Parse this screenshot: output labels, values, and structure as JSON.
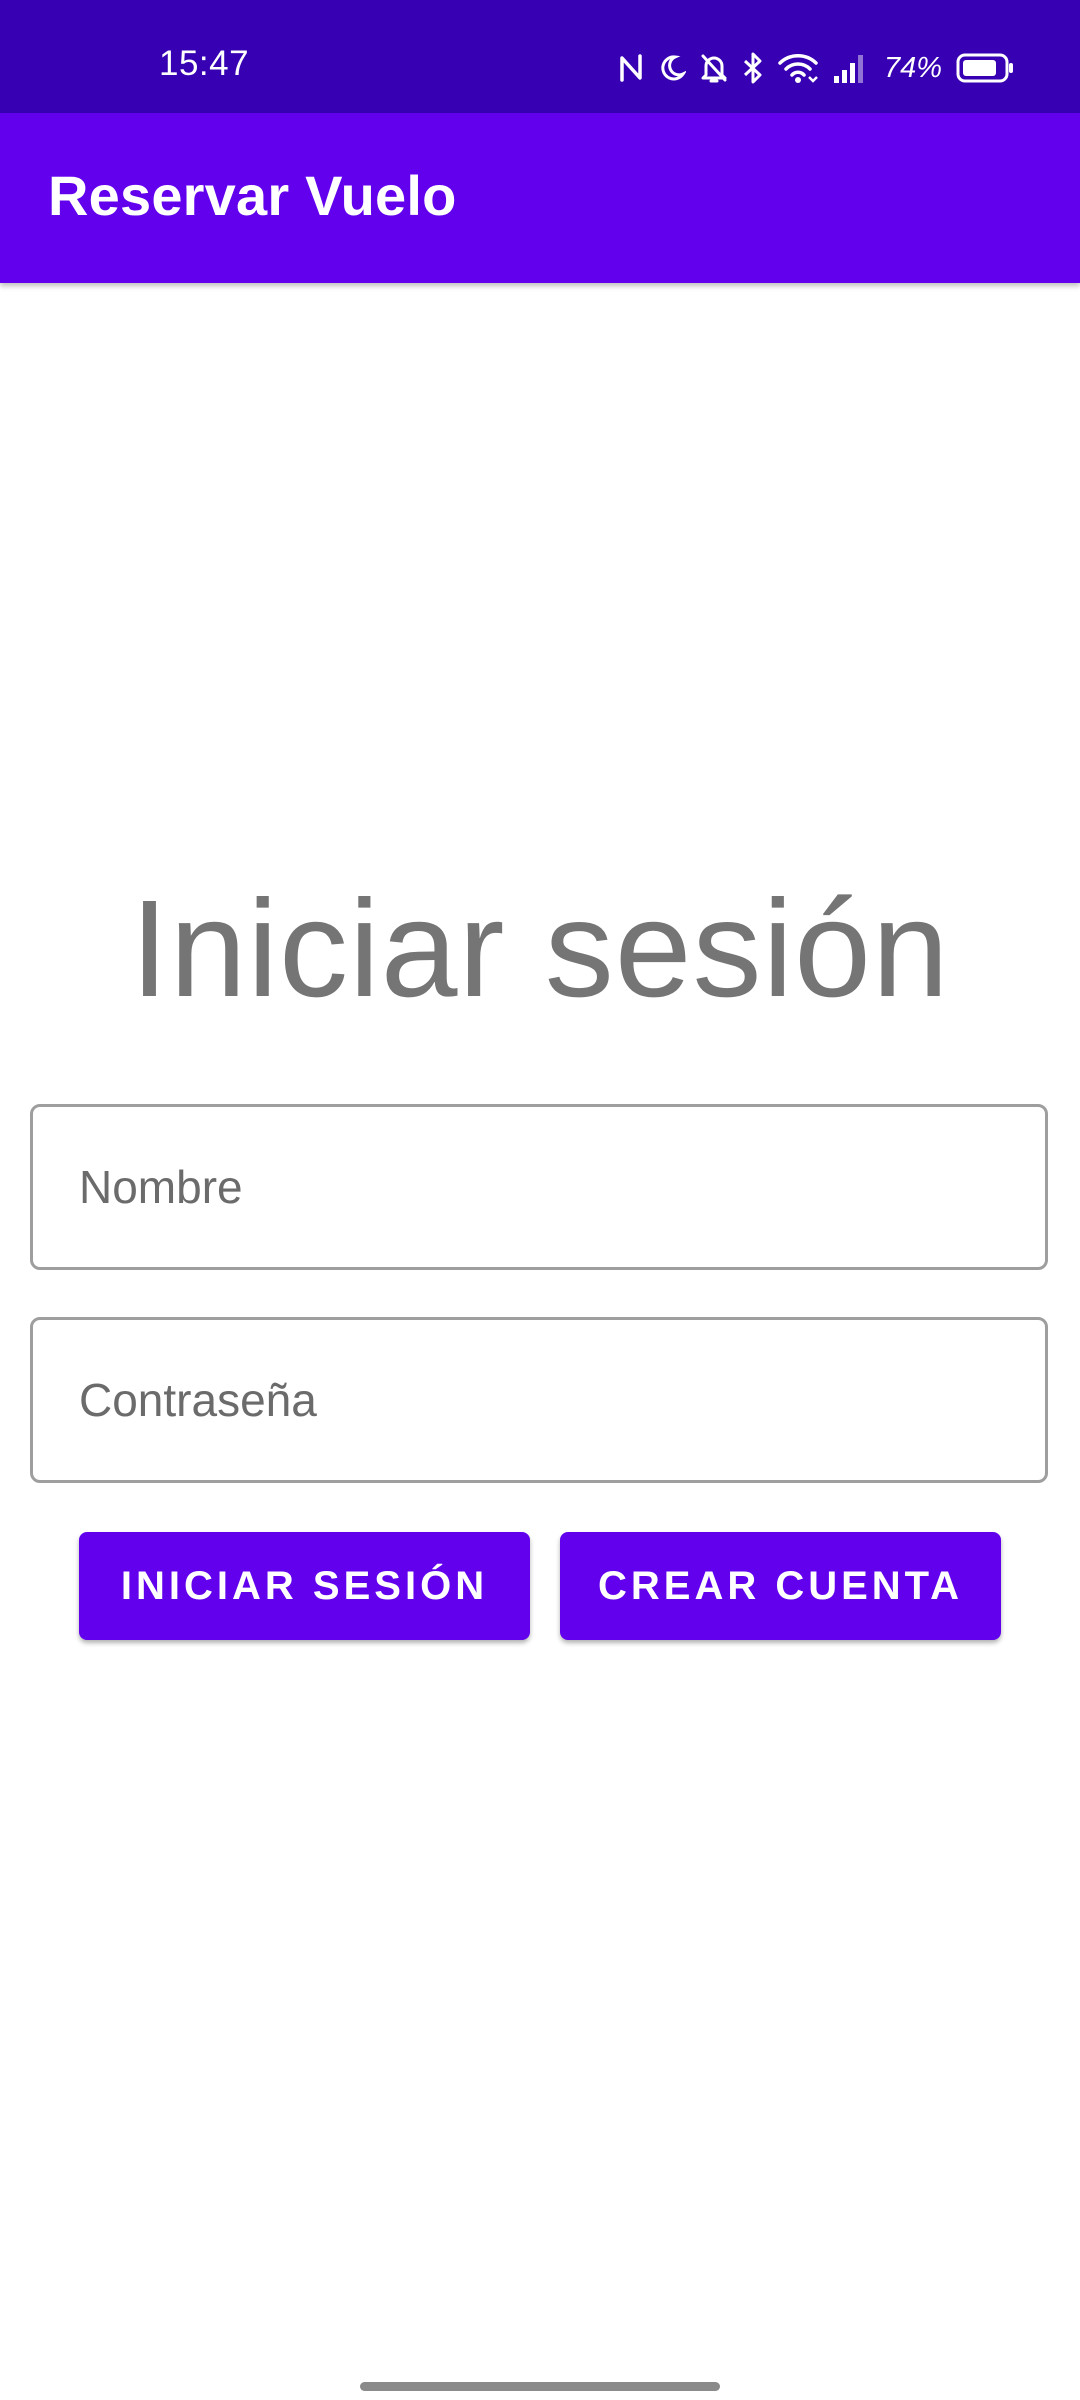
{
  "status_bar": {
    "time": "15:47",
    "battery_percent": "74%",
    "icons": [
      "nfc-icon",
      "do-not-disturb-moon-icon",
      "notifications-off-icon",
      "bluetooth-icon",
      "wifi-icon",
      "signal-icon",
      "battery-icon"
    ]
  },
  "app_bar": {
    "title": "Reservar Vuelo",
    "color": "#6200ee"
  },
  "login": {
    "heading": "Iniciar sesión",
    "name_placeholder": "Nombre",
    "password_placeholder": "Contraseña",
    "login_button": "INICIAR SESIÓN",
    "create_button": "CREAR CUENTA"
  },
  "colors": {
    "status_bar": "#3700b3",
    "primary": "#6200ee",
    "heading_text": "#757575"
  }
}
